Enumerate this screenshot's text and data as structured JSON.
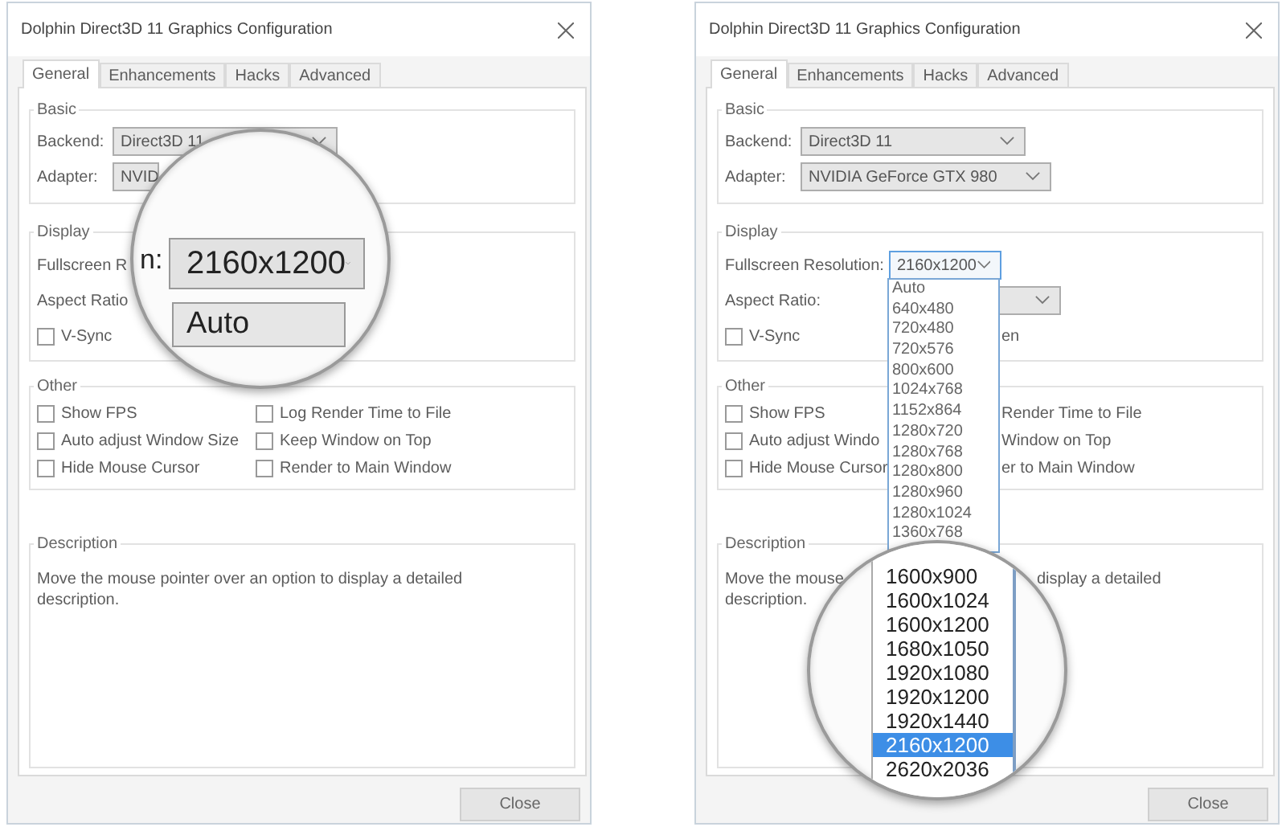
{
  "windows": [
    {
      "title": "Dolphin Direct3D 11 Graphics Configuration",
      "tabs": [
        {
          "label": "General",
          "selected": true
        },
        {
          "label": "Enhancements",
          "selected": false
        },
        {
          "label": "Hacks",
          "selected": false
        },
        {
          "label": "Advanced",
          "selected": false
        }
      ],
      "groups": [
        {
          "title": "Basic",
          "rows": [
            [
              {
                "kind": "label",
                "text": "Backend:"
              },
              {
                "kind": "combo",
                "value": "Direct3D 11",
                "open": false
              }
            ],
            [
              {
                "kind": "label",
                "text": "Adapter:"
              },
              {
                "kind": "combo",
                "value": "NVID",
                "open": false
              }
            ]
          ]
        },
        {
          "title": "Display",
          "rows": [
            [
              {
                "kind": "label",
                "text": "Fullscreen R"
              }
            ],
            [
              {
                "kind": "label",
                "text": "Aspect Ratio"
              }
            ],
            [
              {
                "kind": "checkbox",
                "text": "V-Sync",
                "checked": false
              }
            ]
          ]
        },
        {
          "title": "Other",
          "rows": [
            [
              {
                "kind": "checkbox",
                "text": "Show FPS",
                "checked": false
              },
              {
                "kind": "checkbox",
                "text": "Log Render Time to File",
                "checked": false
              }
            ],
            [
              {
                "kind": "checkbox",
                "text": "Auto adjust Window Size",
                "checked": false
              },
              {
                "kind": "checkbox",
                "text": "Keep Window on Top",
                "checked": false
              }
            ],
            [
              {
                "kind": "checkbox",
                "text": "Hide Mouse Cursor",
                "checked": false
              },
              {
                "kind": "checkbox",
                "text": "Render to Main Window",
                "checked": false
              }
            ]
          ]
        },
        {
          "title": "Description",
          "rows": [
            [
              {
                "kind": "paragraph",
                "text": "Move the mouse pointer over an option to display a detailed description."
              }
            ]
          ]
        }
      ],
      "button": "Close",
      "magnifier": {
        "kind": "combo-zoom",
        "label": "n:",
        "value": "2160x1200",
        "option": "Auto"
      }
    },
    {
      "title": "Dolphin Direct3D 11 Graphics Configuration",
      "tabs": [
        {
          "label": "General",
          "selected": true
        },
        {
          "label": "Enhancements",
          "selected": false
        },
        {
          "label": "Hacks",
          "selected": false
        },
        {
          "label": "Advanced",
          "selected": false
        }
      ],
      "groups": [
        {
          "title": "Basic",
          "rows": [
            [
              {
                "kind": "label",
                "text": "Backend:"
              },
              {
                "kind": "combo",
                "value": "Direct3D 11",
                "open": false
              }
            ],
            [
              {
                "kind": "label",
                "text": "Adapter:"
              },
              {
                "kind": "combo",
                "value": "NVIDIA GeForce GTX 980",
                "open": false
              }
            ]
          ]
        },
        {
          "title": "Display",
          "rows": [
            [
              {
                "kind": "label",
                "text": "Fullscreen Resolution:"
              },
              {
                "kind": "combo",
                "value": "2160x1200",
                "open": true
              }
            ],
            [
              {
                "kind": "label",
                "text": "Aspect Ratio:"
              },
              {
                "kind": "combo",
                "open": false
              }
            ],
            [
              {
                "kind": "checkbox",
                "text": "V-Sync",
                "checked": false
              },
              {
                "kind": "fragment",
                "text": "en"
              }
            ]
          ],
          "dropdown_list": [
            {
              "label": "Auto",
              "selected": false
            },
            {
              "label": "640x480",
              "selected": false
            },
            {
              "label": "720x480",
              "selected": false
            },
            {
              "label": "720x576",
              "selected": false
            },
            {
              "label": "800x600",
              "selected": false
            },
            {
              "label": "1024x768",
              "selected": false
            },
            {
              "label": "1152x864",
              "selected": false
            },
            {
              "label": "1280x720",
              "selected": false
            },
            {
              "label": "1280x768",
              "selected": false
            },
            {
              "label": "1280x800",
              "selected": false
            },
            {
              "label": "1280x960",
              "selected": false
            },
            {
              "label": "1280x1024",
              "selected": false
            },
            {
              "label": "1360x768",
              "selected": false
            }
          ]
        },
        {
          "title": "Other",
          "rows": [
            [
              {
                "kind": "checkbox",
                "text": "Show FPS",
                "checked": false
              },
              {
                "kind": "fragment",
                "text": "Render Time to File"
              }
            ],
            [
              {
                "kind": "checkbox",
                "text": "Auto adjust Windo",
                "checked": false
              },
              {
                "kind": "fragment",
                "text": "Window on Top"
              }
            ],
            [
              {
                "kind": "checkbox",
                "text": "Hide Mouse Cursor",
                "checked": false
              },
              {
                "kind": "fragment",
                "text": "er to Main Window"
              }
            ]
          ]
        },
        {
          "title": "Description",
          "rows": [
            [
              {
                "kind": "text",
                "text": "Move the mouse"
              },
              {
                "kind": "fragment",
                "text": "display a detailed"
              }
            ],
            [
              {
                "kind": "text",
                "text": "description."
              }
            ]
          ]
        }
      ],
      "button": "Close",
      "magnifier": {
        "kind": "list-zoom",
        "options": [
          {
            "label": "1600x900",
            "selected": false
          },
          {
            "label": "1600x1024",
            "selected": false
          },
          {
            "label": "1600x1200",
            "selected": false
          },
          {
            "label": "1680x1050",
            "selected": false
          },
          {
            "label": "1920x1080",
            "selected": false
          },
          {
            "label": "1920x1200",
            "selected": false
          },
          {
            "label": "1920x1440",
            "selected": false
          },
          {
            "label": "2160x1200",
            "selected": true
          },
          {
            "label": "2620x2036",
            "selected": false
          }
        ]
      }
    }
  ]
}
